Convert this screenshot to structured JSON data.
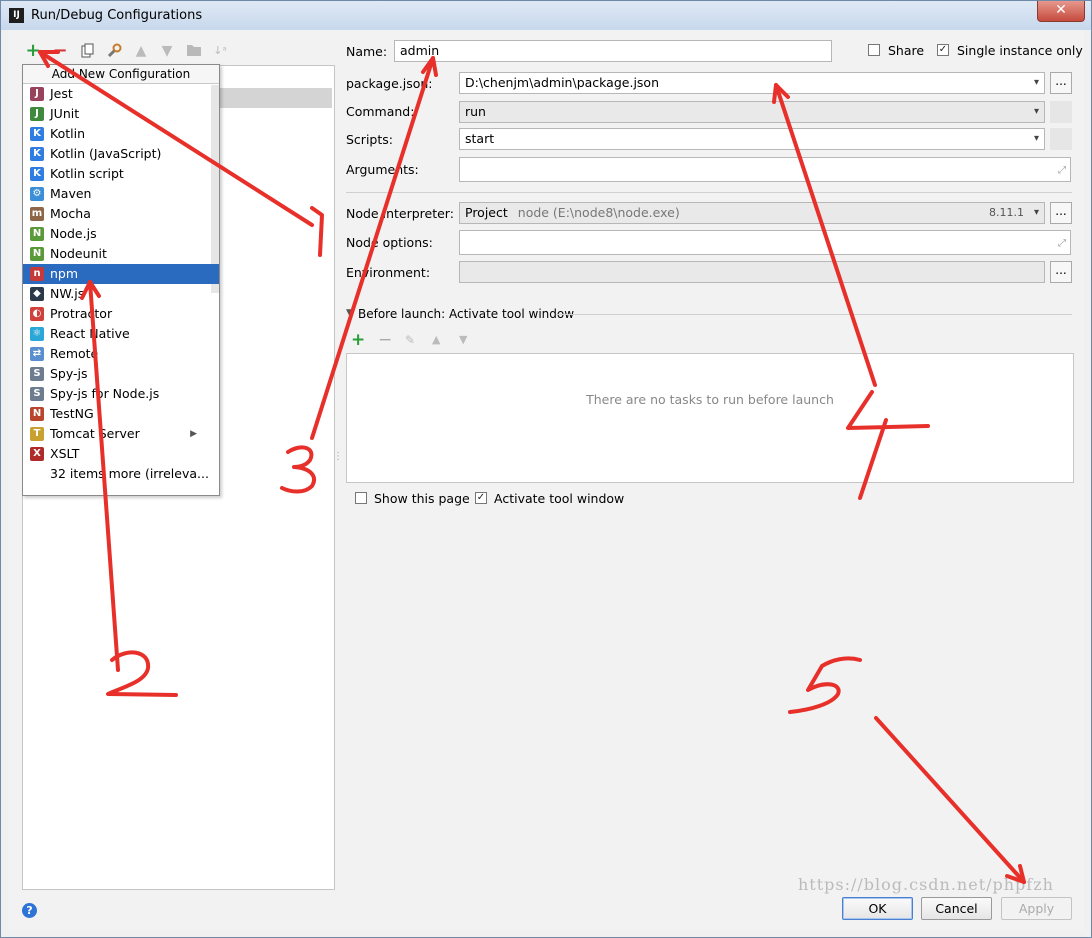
{
  "window": {
    "title": "Run/Debug Configurations",
    "app_icon": "IJ",
    "close_glyph": "✕"
  },
  "toolbar": {
    "add_glyph": "+",
    "remove_glyph": "−"
  },
  "popup": {
    "header": "Add New Configuration",
    "items": [
      {
        "label": "Jest",
        "icon": "jest-icon",
        "color": "#99425b",
        "glyph": "J"
      },
      {
        "label": "JUnit",
        "icon": "junit-icon",
        "color": "#3f8a3f",
        "glyph": "J"
      },
      {
        "label": "Kotlin",
        "icon": "kotlin-icon",
        "color": "#2f7de1",
        "glyph": "K"
      },
      {
        "label": "Kotlin (JavaScript)",
        "icon": "kotlin-js-icon",
        "color": "#2f7de1",
        "glyph": "K"
      },
      {
        "label": "Kotlin script",
        "icon": "kotlin-script-icon",
        "color": "#2f7de1",
        "glyph": "K"
      },
      {
        "label": "Maven",
        "icon": "maven-gear-icon",
        "color": "#3b8fd6",
        "glyph": "⚙"
      },
      {
        "label": "Mocha",
        "icon": "mocha-icon",
        "color": "#8d6748",
        "glyph": "m"
      },
      {
        "label": "Node.js",
        "icon": "nodejs-icon",
        "color": "#5b9a3a",
        "glyph": "N"
      },
      {
        "label": "Nodeunit",
        "icon": "nodeunit-icon",
        "color": "#5b9a3a",
        "glyph": "N"
      },
      {
        "label": "npm",
        "icon": "npm-icon",
        "color": "#c43a3a",
        "glyph": "n"
      },
      {
        "label": "NW.js",
        "icon": "nwjs-icon",
        "color": "#2b3a4a",
        "glyph": "◆"
      },
      {
        "label": "Protractor",
        "icon": "protractor-icon",
        "color": "#d0413b",
        "glyph": "◐"
      },
      {
        "label": "React Native",
        "icon": "react-icon",
        "color": "#2aa6d8",
        "glyph": "⚛"
      },
      {
        "label": "Remote",
        "icon": "remote-icon",
        "color": "#5a8fcf",
        "glyph": "⇄"
      },
      {
        "label": "Spy-js",
        "icon": "spyjs-icon",
        "color": "#6d7d8f",
        "glyph": "S"
      },
      {
        "label": "Spy-js for Node.js",
        "icon": "spyjs-node-icon",
        "color": "#6d7d8f",
        "glyph": "S"
      },
      {
        "label": "TestNG",
        "icon": "testng-icon",
        "color": "#b8452c",
        "glyph": "N"
      },
      {
        "label": "Tomcat Server",
        "icon": "tomcat-icon",
        "color": "#c9a130",
        "glyph": "T"
      },
      {
        "label": "XSLT",
        "icon": "xslt-icon",
        "color": "#b02a2a",
        "glyph": "X"
      },
      {
        "label": "32 items more (irreleva...",
        "icon": "",
        "color": "",
        "glyph": ""
      }
    ],
    "selected_index": 9,
    "submenu_arrow": "▶"
  },
  "form": {
    "name_label": "Name:",
    "name_value": "admin",
    "share_label": "Share",
    "share_checked": false,
    "single_instance_label": "Single instance only",
    "single_instance_checked": true,
    "package_json_label": "package.json:",
    "package_json_value": "D:\\chenjm\\admin\\package.json",
    "command_label": "Command:",
    "command_value": "run",
    "scripts_label": "Scripts:",
    "scripts_value": "start",
    "arguments_label": "Arguments:",
    "arguments_value": "",
    "node_interpreter_label": "Node interpreter:",
    "node_interpreter_prefix": "Project",
    "node_interpreter_path": "node (E:\\node8\\node.exe)",
    "node_interpreter_version": "8.11.1",
    "node_options_label": "Node options:",
    "node_options_value": "",
    "environment_label": "Environment:",
    "environment_value": "",
    "browse_label": "...",
    "dropdown_glyph": "▾",
    "expand_glyph": "⤢"
  },
  "before_launch": {
    "title": "Before launch: Activate tool window",
    "empty_text": "There are no tasks to run before launch",
    "show_page_label": "Show this page",
    "show_page_checked": false,
    "activate_label": "Activate tool window",
    "activate_checked": true
  },
  "buttons": {
    "ok": "OK",
    "cancel": "Cancel",
    "apply": "Apply",
    "help": "?"
  },
  "watermark": "https://blog.csdn.net/phpfzh",
  "annotations": {
    "numbers": [
      "1",
      "2",
      "3",
      "4",
      "5"
    ],
    "color": "#e8302a"
  }
}
